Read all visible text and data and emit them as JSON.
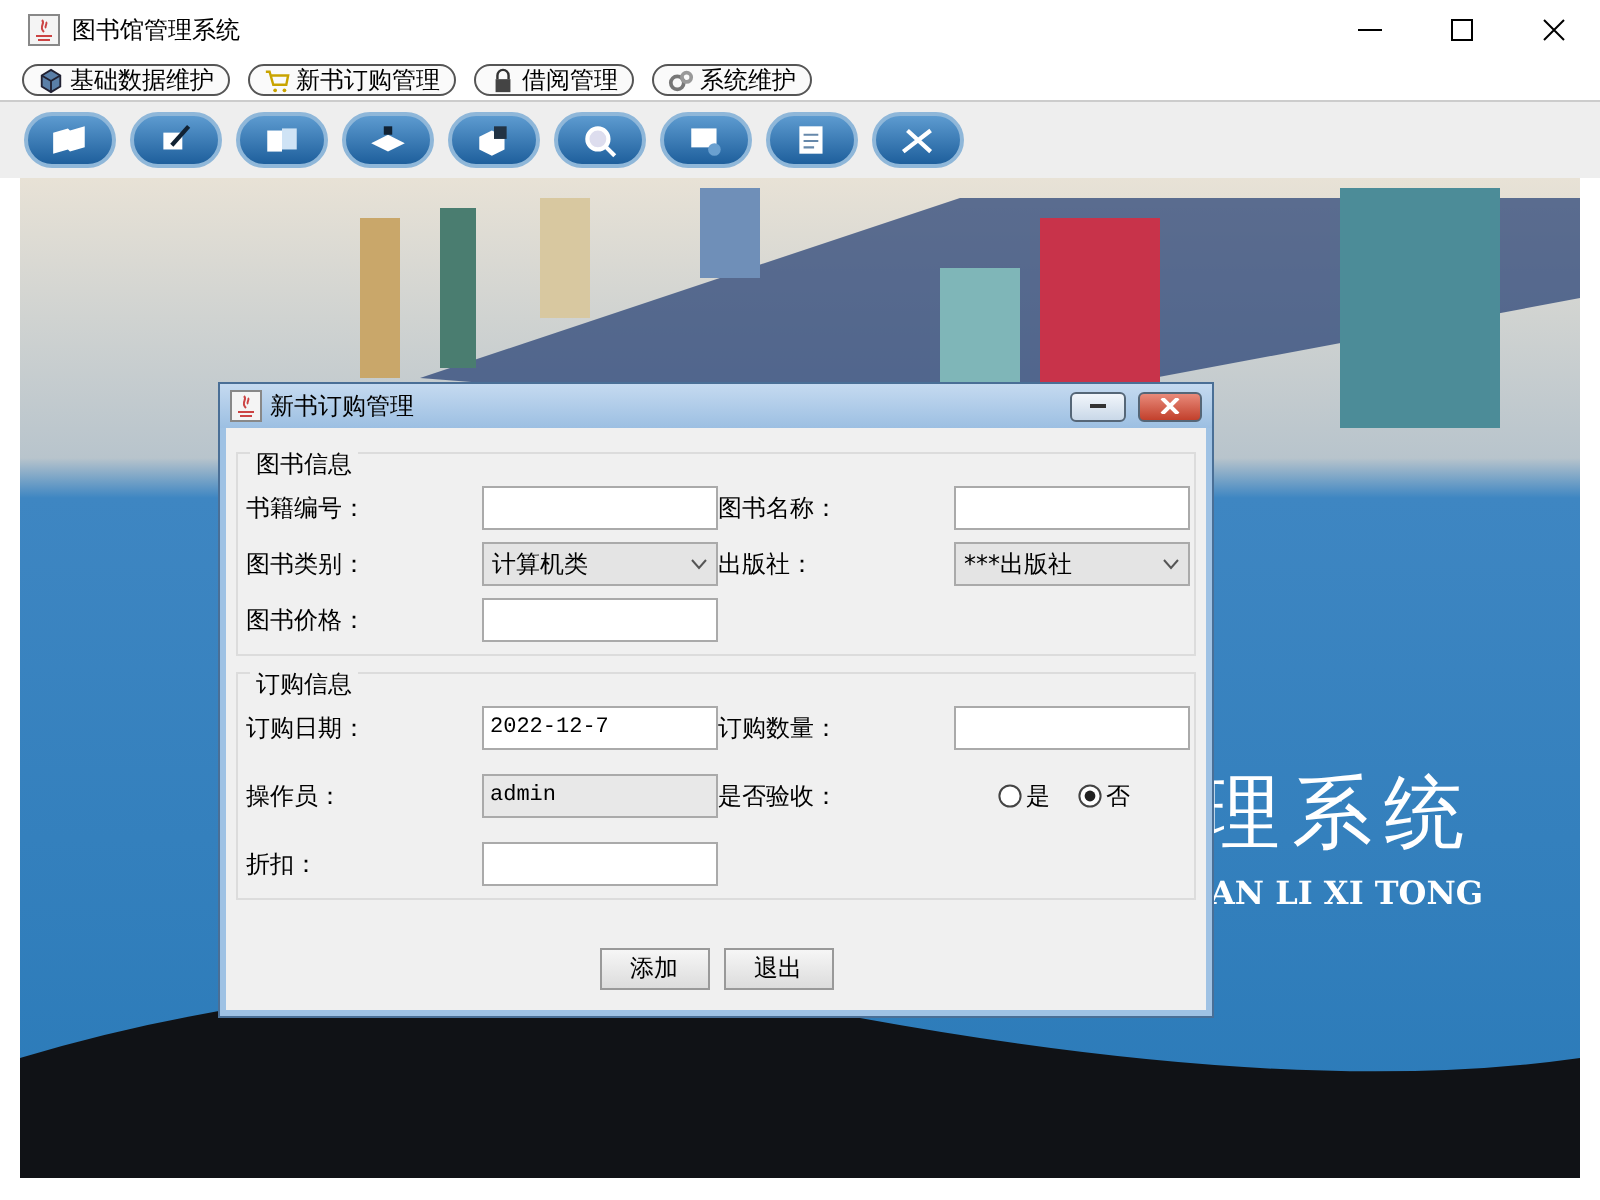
{
  "window": {
    "title": "图书馆管理系统"
  },
  "menu": [
    {
      "label": "基础数据维护",
      "kind": "cube"
    },
    {
      "label": "新书订购管理",
      "kind": "cart"
    },
    {
      "label": "借阅管理",
      "kind": "lock"
    },
    {
      "label": "系统维护",
      "kind": "gears"
    }
  ],
  "toolbar": [
    {
      "kind": "book"
    },
    {
      "kind": "pen"
    },
    {
      "kind": "folders"
    },
    {
      "kind": "tray"
    },
    {
      "kind": "box"
    },
    {
      "kind": "search"
    },
    {
      "kind": "monitor"
    },
    {
      "kind": "checklist"
    },
    {
      "kind": "tools"
    }
  ],
  "banner": {
    "title": "理系统",
    "subtitle": "AN LI XI TONG"
  },
  "dialog": {
    "title": "新书订购管理",
    "groups": [
      {
        "title": "图书信息",
        "fields": [
          {
            "label": "书籍编号：",
            "kind": "text"
          },
          {
            "label": "图书名称：",
            "kind": "text"
          },
          {
            "label": "图书类别：",
            "kind": "combo",
            "value": "计算机类"
          },
          {
            "label": "出版社：",
            "kind": "combo",
            "value": "***出版社"
          },
          {
            "label": "图书价格：",
            "kind": "text"
          }
        ]
      },
      {
        "title": "订购信息",
        "fields": [
          {
            "label": "订购日期：",
            "kind": "text",
            "value": "2022-12-7"
          },
          {
            "label": "订购数量：",
            "kind": "text"
          },
          {
            "label": "操作员：",
            "kind": "readonly",
            "value": "admin"
          },
          {
            "label": "是否验收：",
            "kind": "radio",
            "options": [
              {
                "label": "是",
                "selected": false
              },
              {
                "label": "否",
                "selected": true
              }
            ]
          },
          {
            "label": "折扣：",
            "kind": "text"
          }
        ]
      }
    ],
    "buttons": [
      "添加",
      "退出"
    ]
  }
}
